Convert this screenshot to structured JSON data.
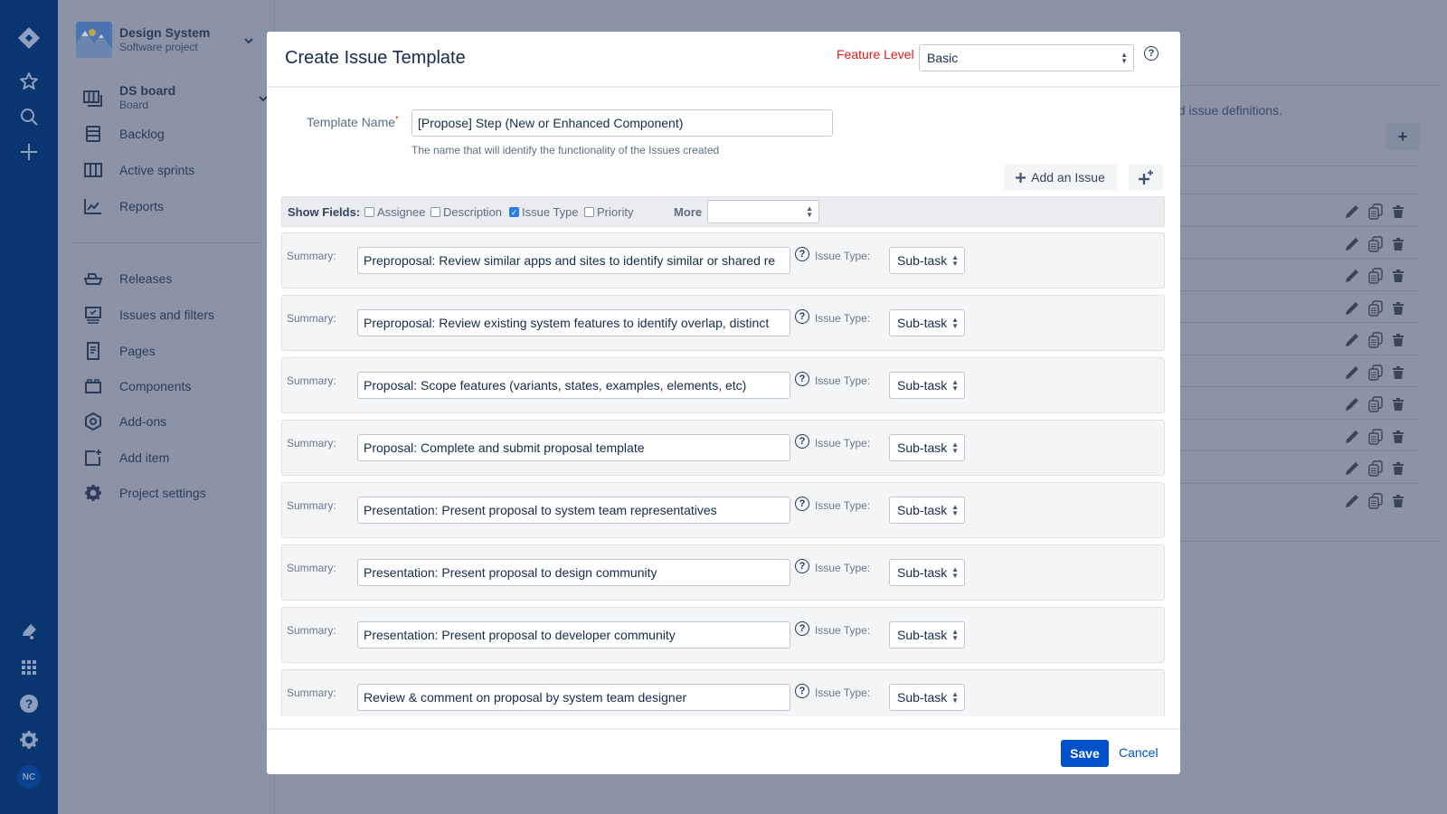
{
  "global_nav": {
    "top_icons": [
      "jira-logo-icon",
      "star-icon",
      "search-icon",
      "create-plus-icon"
    ],
    "bottom_icons": [
      "notifications-icon",
      "app-switcher-icon",
      "help-icon",
      "settings-icon"
    ],
    "avatar_initials": "NC"
  },
  "project": {
    "name": "Design System",
    "type": "Software project"
  },
  "sidebar": {
    "board": {
      "label": "DS board",
      "sublabel": "Board"
    },
    "items": [
      {
        "label": "Backlog",
        "icon": "backlog-icon"
      },
      {
        "label": "Active sprints",
        "icon": "active-sprints-icon"
      },
      {
        "label": "Reports",
        "icon": "reports-icon"
      },
      {
        "label": "Releases",
        "icon": "releases-icon"
      },
      {
        "label": "Issues and filters",
        "icon": "issues-filters-icon"
      },
      {
        "label": "Pages",
        "icon": "pages-icon"
      },
      {
        "label": "Components",
        "icon": "components-icon"
      },
      {
        "label": "Add-ons",
        "icon": "add-ons-icon"
      },
      {
        "label": "Add item",
        "icon": "add-item-icon"
      },
      {
        "label": "Project settings",
        "icon": "project-settings-icon"
      }
    ]
  },
  "background": {
    "description_fragment": "ed issue definitions.",
    "row_count": 10
  },
  "modal": {
    "title": "Create Issue Template",
    "feature_level_label": "Feature Level",
    "feature_level_value": "Basic",
    "template_name_label": "Template Name",
    "required_marker": "*",
    "template_name_value": "[Propose] Step (New or Enhanced Component)",
    "template_name_help": "The name that will identify the functionality of the Issues created",
    "add_issue_label": "Add an Issue",
    "show_fields": {
      "label": "Show Fields:",
      "options": [
        {
          "label": "Assignee",
          "checked": false
        },
        {
          "label": "Description",
          "checked": false
        },
        {
          "label": "Issue Type",
          "checked": true
        },
        {
          "label": "Priority",
          "checked": false
        }
      ],
      "more_label": "More",
      "more_value": ""
    },
    "summary_label": "Summary:",
    "issue_type_label": "Issue Type:",
    "issues": [
      {
        "summary": "Preproposal: Review similar apps and sites to identify similar or shared re",
        "issue_type": "Sub-task"
      },
      {
        "summary": "Preproposal: Review existing system features to identify overlap, distinct",
        "issue_type": "Sub-task"
      },
      {
        "summary": "Proposal: Scope features (variants, states, examples, elements, etc)",
        "issue_type": "Sub-task"
      },
      {
        "summary": "Proposal: Complete and submit proposal template",
        "issue_type": "Sub-task"
      },
      {
        "summary": "Presentation: Present proposal to system team representatives",
        "issue_type": "Sub-task"
      },
      {
        "summary": "Presentation: Present proposal to design community",
        "issue_type": "Sub-task"
      },
      {
        "summary": "Presentation: Present proposal to developer community",
        "issue_type": "Sub-task"
      },
      {
        "summary": "Review & comment on proposal by system team designer",
        "issue_type": "Sub-task"
      }
    ],
    "save_label": "Save",
    "cancel_label": "Cancel"
  },
  "colors": {
    "primary": "#0052cc",
    "feature_level": "#de1a1a",
    "global_nav": "#0a3670",
    "overlay": "#8a94a6"
  }
}
